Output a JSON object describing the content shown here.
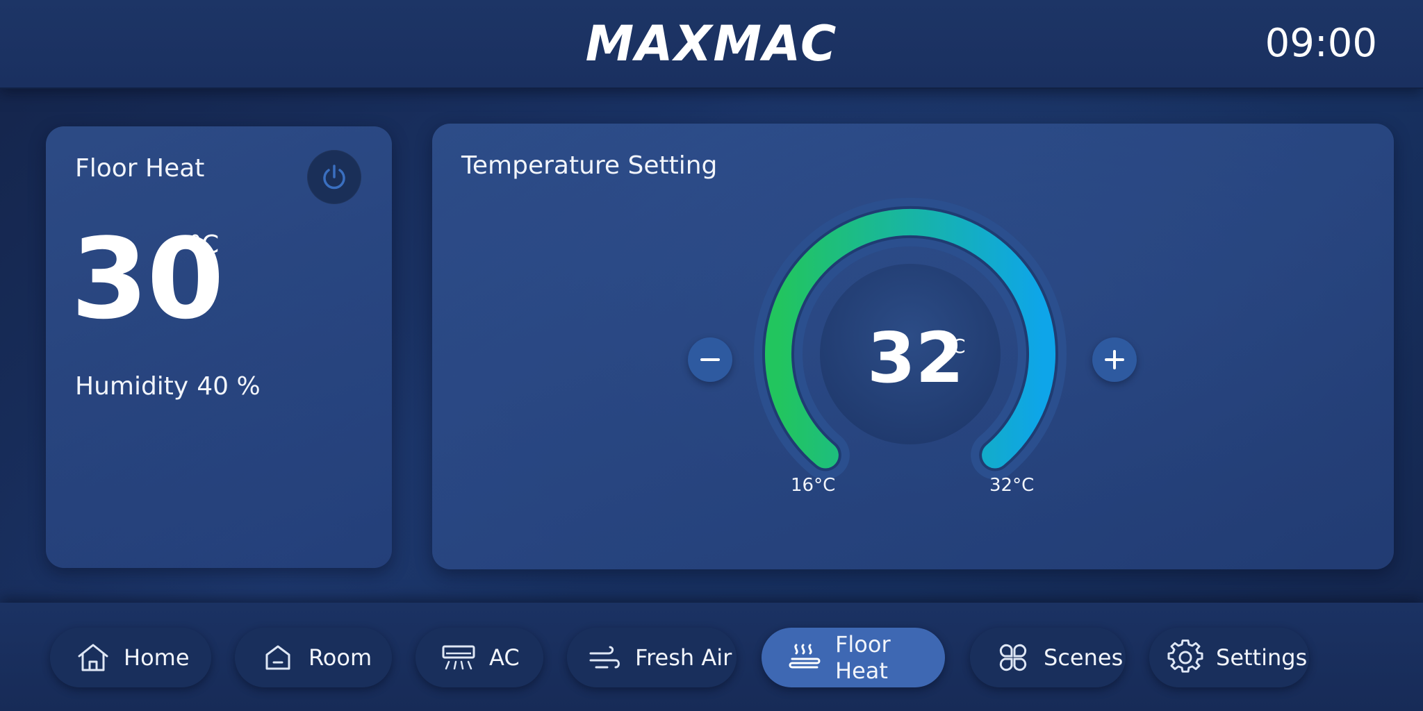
{
  "header": {
    "logo": "MAXMAC",
    "time": "09:00"
  },
  "floor_heat_card": {
    "title": "Floor Heat",
    "current_temp": "30",
    "temp_unit": "°C",
    "humidity_label": "Humidity",
    "humidity_value": "40 %",
    "power_icon": "power-icon"
  },
  "temperature_card": {
    "title": "Temperature Setting",
    "set_temp": "32",
    "set_unit": "°C",
    "min_label": "16°C",
    "max_label": "32°C",
    "min_value": 16,
    "max_value": 32,
    "current_value": 32,
    "gradient_start": "#22c55e",
    "gradient_end": "#0ea5e9"
  },
  "nav": {
    "items": [
      {
        "label": "Home",
        "icon": "home-icon"
      },
      {
        "label": "Room",
        "icon": "room-icon"
      },
      {
        "label": "AC",
        "icon": "ac-icon"
      },
      {
        "label": "Fresh Air",
        "icon": "fresh-air-icon"
      },
      {
        "label": "Floor Heat",
        "icon": "floor-heat-icon",
        "active": true
      },
      {
        "label": "Scenes",
        "icon": "scenes-icon"
      },
      {
        "label": "Settings",
        "icon": "gear-icon"
      }
    ]
  }
}
